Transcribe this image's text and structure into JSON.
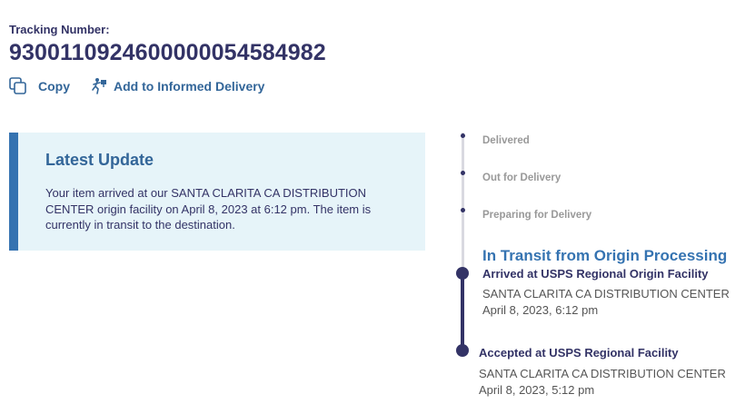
{
  "tracking": {
    "label": "Tracking Number:",
    "number": "9300110924600000054584982"
  },
  "actions": {
    "copy_label": "Copy",
    "informed_label": "Add to Informed Delivery"
  },
  "latest_update": {
    "title": "Latest Update",
    "text": "Your item arrived at our SANTA CLARITA CA DISTRIBUTION CENTER origin facility on April 8, 2023 at 6:12 pm. The item is currently in transit to the destination."
  },
  "timeline": {
    "steps": [
      {
        "label": "Delivered"
      },
      {
        "label": "Out for Delivery"
      },
      {
        "label": "Preparing for Delivery"
      }
    ],
    "current_status": "In Transit from Origin Processing",
    "events": [
      {
        "title": "Arrived at USPS Regional Origin Facility",
        "location": "SANTA CLARITA CA DISTRIBUTION CENTER",
        "datetime": "April 8, 2023, 6:12 pm"
      },
      {
        "title": "Accepted at USPS Regional Facility",
        "location": "SANTA CLARITA CA DISTRIBUTION CENTER",
        "datetime": "April 8, 2023, 5:12 pm"
      }
    ]
  },
  "colors": {
    "navy": "#333366",
    "link_blue": "#336699",
    "card_bg": "#e6f4f9",
    "card_border": "#3573b1",
    "muted": "#999999"
  }
}
